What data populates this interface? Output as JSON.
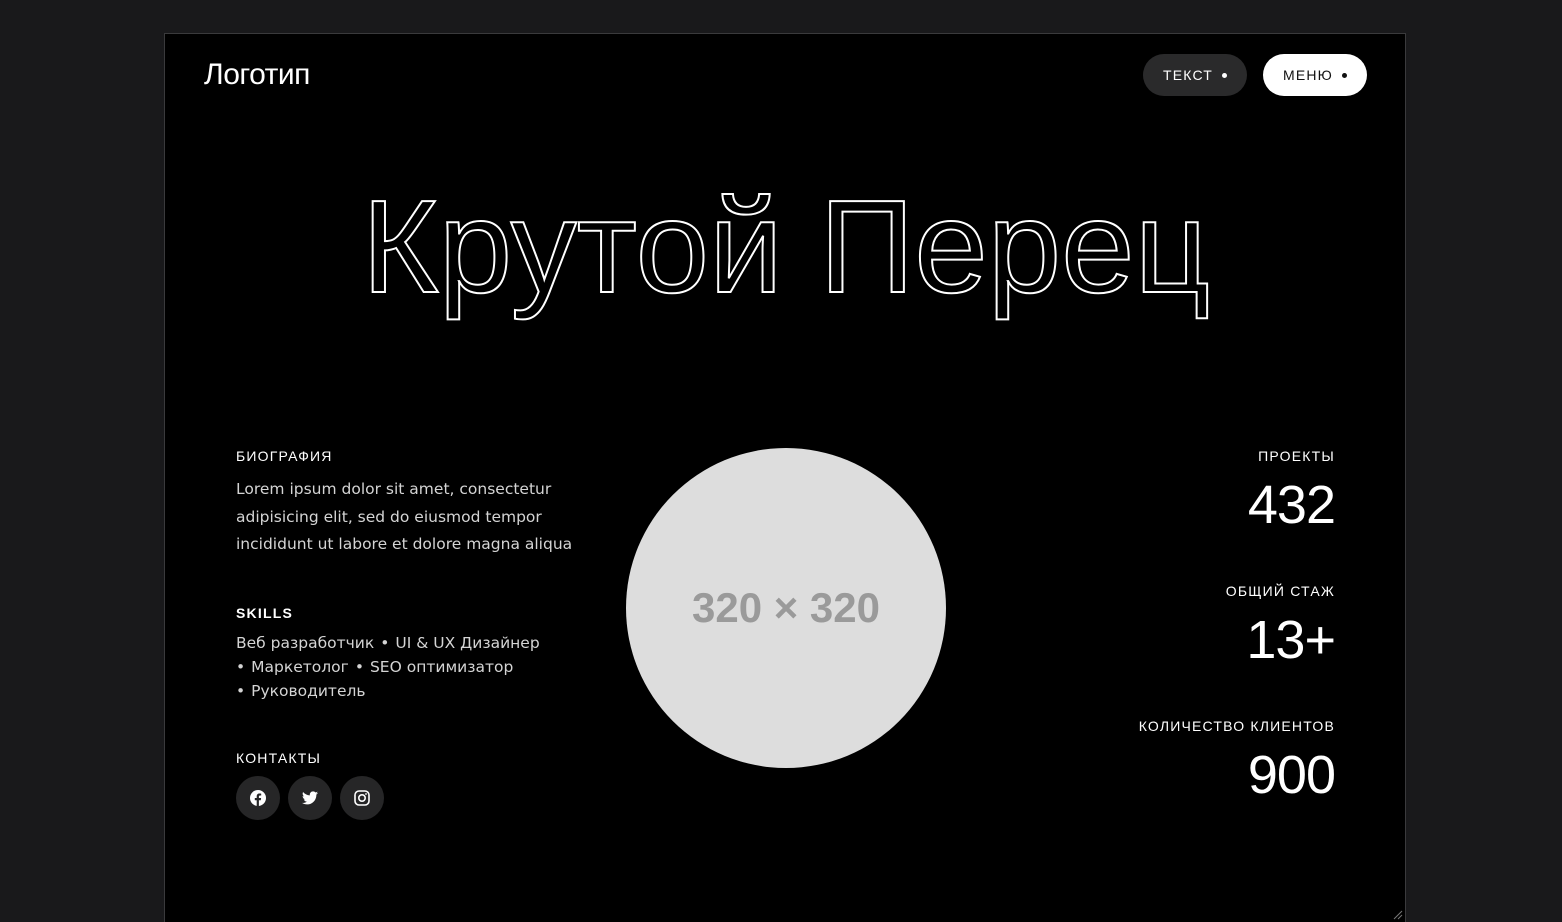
{
  "header": {
    "logo": "Логотип",
    "text_button": "ТЕКСТ",
    "menu_button": "МЕНЮ"
  },
  "hero": {
    "title": "Крутой Перец"
  },
  "bio": {
    "label": "БИОГРАФИЯ",
    "text": "Lorem ipsum dolor sit amet, consectetur adipisicing elit, sed do eiusmod tempor incididunt ut labore et dolore magna aliqua"
  },
  "skills": {
    "label": "SKILLS",
    "items": [
      "Веб разработчик",
      "UI & UX Дизайнер",
      "Маркетолог",
      "SEO оптимизатор",
      "Руководитель"
    ]
  },
  "contacts": {
    "label": "КОНТАКТЫ",
    "icons": [
      "facebook-icon",
      "twitter-icon",
      "instagram-icon"
    ]
  },
  "avatar": {
    "placeholder": "320 × 320"
  },
  "stats": [
    {
      "label": "ПРОЕКТЫ",
      "value": "432"
    },
    {
      "label": "ОБЩИЙ СТАЖ",
      "value": "13+"
    },
    {
      "label": "КОЛИЧЕСТВО КЛИЕНТОВ",
      "value": "900"
    }
  ],
  "colors": {
    "page_background": "#19191b",
    "frame_background": "#000000",
    "pill_dark": "#2a2a2b",
    "pill_light": "#ffffff",
    "avatar_placeholder": "#dddddd"
  }
}
